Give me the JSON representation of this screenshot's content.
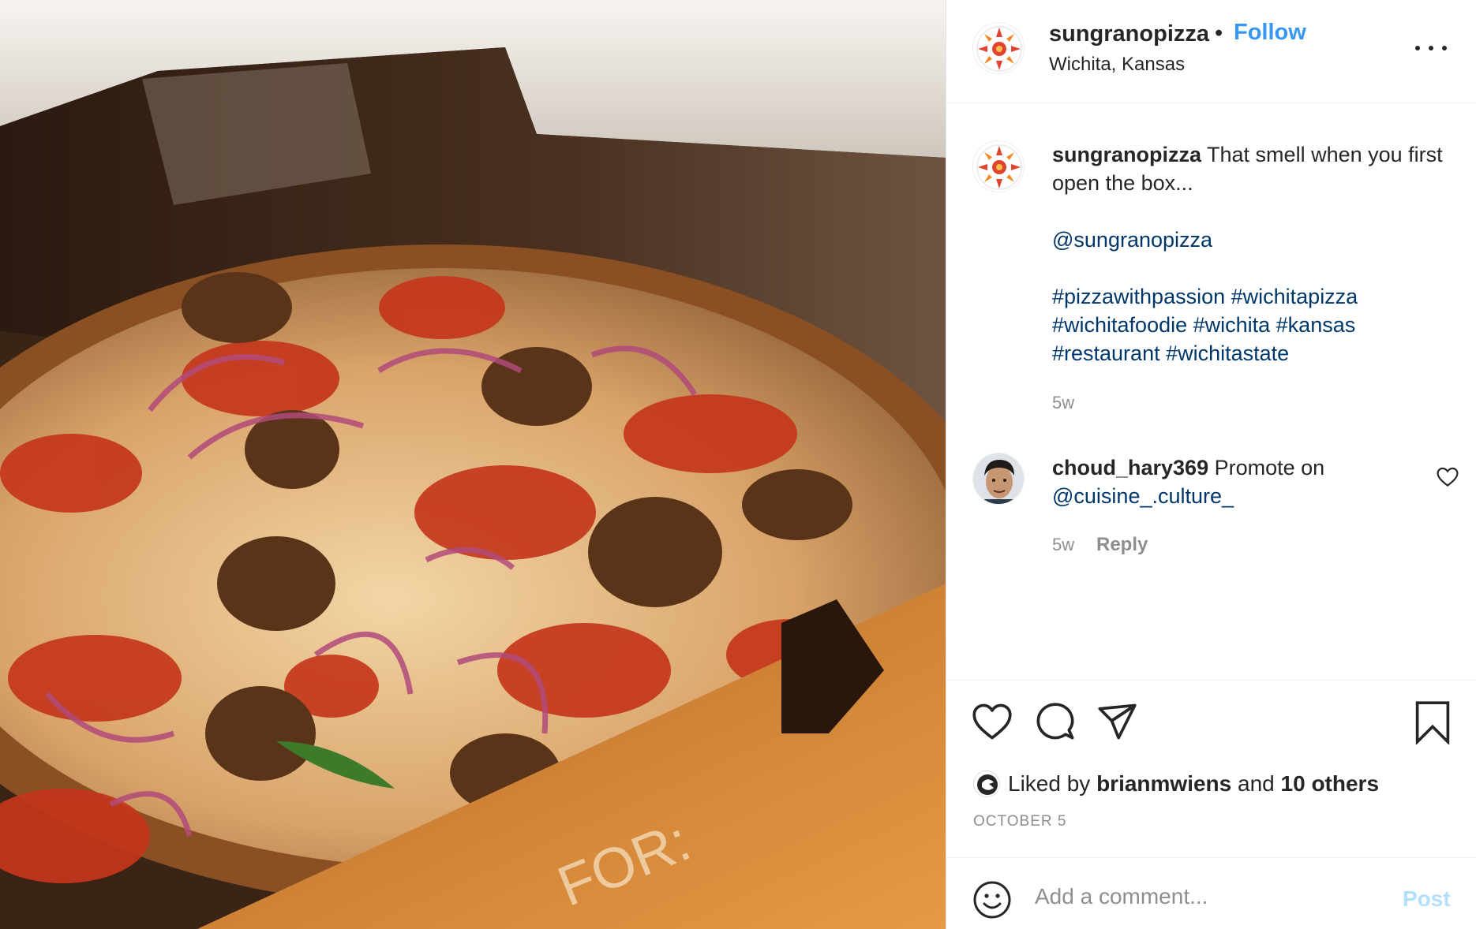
{
  "photo": {
    "box_text": "FOR:"
  },
  "header": {
    "username": "sungranopizza",
    "separator": "•",
    "follow_label": "Follow",
    "location": "Wichita, Kansas",
    "more_icon": "more-horizontal-icon"
  },
  "caption": {
    "username": "sungranopizza",
    "text": "That smell when you first open the box...",
    "mention": "@sungranopizza",
    "hashtags_line1": "#pizzawithpassion #wichitapizza",
    "hashtags_line2": "#wichitafoodie #wichita #kansas",
    "hashtags_line3": "#restaurant #wichitastate",
    "time": "5w"
  },
  "comment": {
    "username": "choud_hary369",
    "text": "Promote on",
    "mention": "@cuisine_.culture_",
    "time": "5w",
    "reply_label": "Reply"
  },
  "actions": {
    "like_icon": "heart-icon",
    "comment_icon": "comment-icon",
    "share_icon": "paper-plane-icon",
    "save_icon": "bookmark-icon"
  },
  "likes": {
    "prefix": "Liked by",
    "user": "brianmwiens",
    "and": "and",
    "others": "10 others"
  },
  "date": "OCTOBER 5",
  "add_comment": {
    "placeholder": "Add a comment...",
    "post_label": "Post"
  },
  "colors": {
    "link_blue": "#3897f0",
    "hashtag": "#00376b",
    "muted": "#8e8e8e",
    "post_disabled": "#b2dffc"
  }
}
